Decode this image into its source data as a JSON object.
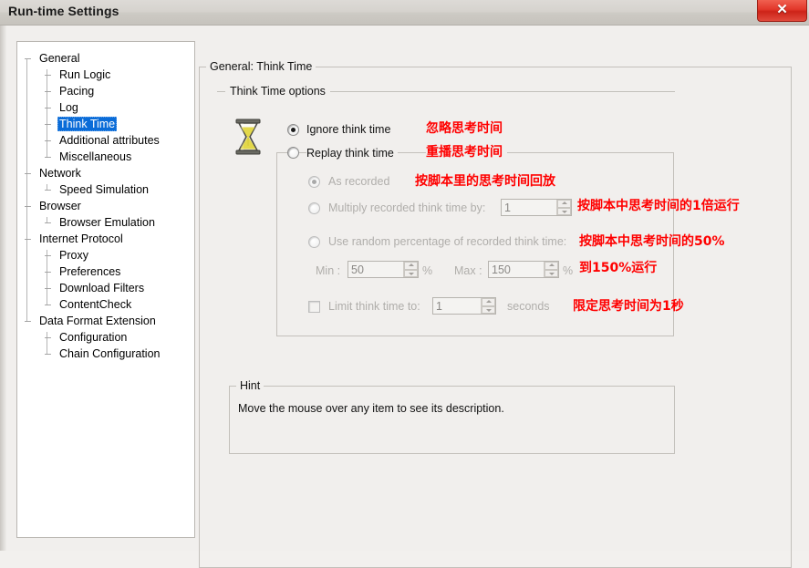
{
  "window": {
    "title": "Run-time Settings",
    "close_label": "✕"
  },
  "tree": {
    "nodes": [
      {
        "label": "General",
        "depth": 0,
        "selected": false
      },
      {
        "label": "Run Logic",
        "depth": 1,
        "selected": false
      },
      {
        "label": "Pacing",
        "depth": 1,
        "selected": false
      },
      {
        "label": "Log",
        "depth": 1,
        "selected": false
      },
      {
        "label": "Think Time",
        "depth": 1,
        "selected": true
      },
      {
        "label": "Additional attributes",
        "depth": 1,
        "selected": false
      },
      {
        "label": "Miscellaneous",
        "depth": 1,
        "selected": false
      },
      {
        "label": "Network",
        "depth": 0,
        "selected": false
      },
      {
        "label": "Speed Simulation",
        "depth": 1,
        "selected": false
      },
      {
        "label": "Browser",
        "depth": 0,
        "selected": false
      },
      {
        "label": "Browser Emulation",
        "depth": 1,
        "selected": false
      },
      {
        "label": "Internet Protocol",
        "depth": 0,
        "selected": false
      },
      {
        "label": "Proxy",
        "depth": 1,
        "selected": false
      },
      {
        "label": "Preferences",
        "depth": 1,
        "selected": false
      },
      {
        "label": "Download Filters",
        "depth": 1,
        "selected": false
      },
      {
        "label": "ContentCheck",
        "depth": 1,
        "selected": false
      },
      {
        "label": "Data Format Extension",
        "depth": 0,
        "selected": false
      },
      {
        "label": "Configuration",
        "depth": 1,
        "selected": false
      },
      {
        "label": "Chain Configuration",
        "depth": 1,
        "selected": false
      }
    ]
  },
  "panel": {
    "group_title": "General: Think Time",
    "options_title": "Think Time options",
    "ignore": {
      "label": "Ignore think time",
      "note": "忽略思考时间",
      "checked": true
    },
    "replay": {
      "label": "Replay think time",
      "note": "重播思考时间",
      "checked": false
    },
    "as_recorded": {
      "label": "As recorded",
      "note": "按脚本里的思考时间回放",
      "checked": true
    },
    "multiply": {
      "label": "Multiply recorded think time by:",
      "note": "按脚本中思考时间的1倍运行",
      "value": "1",
      "checked": false
    },
    "random": {
      "label": "Use random percentage of recorded think time:",
      "note_line1": "按脚本中思考时间的50%",
      "note_line2": "到150%运行",
      "checked": false,
      "min_label": "Min :",
      "min_value": "50",
      "min_unit": "%",
      "max_label": "Max :",
      "max_value": "150",
      "max_unit": "%"
    },
    "limit": {
      "label": "Limit think time to:",
      "value": "1",
      "unit": "seconds",
      "note": "限定思考时间为1秒",
      "checked": false
    }
  },
  "hint": {
    "title": "Hint",
    "text": "Move the mouse over any item to see its description."
  },
  "colors": {
    "accent_red": "#ff0000",
    "selection_blue": "#0a6cd8",
    "dialog_bg": "#f1efed"
  }
}
